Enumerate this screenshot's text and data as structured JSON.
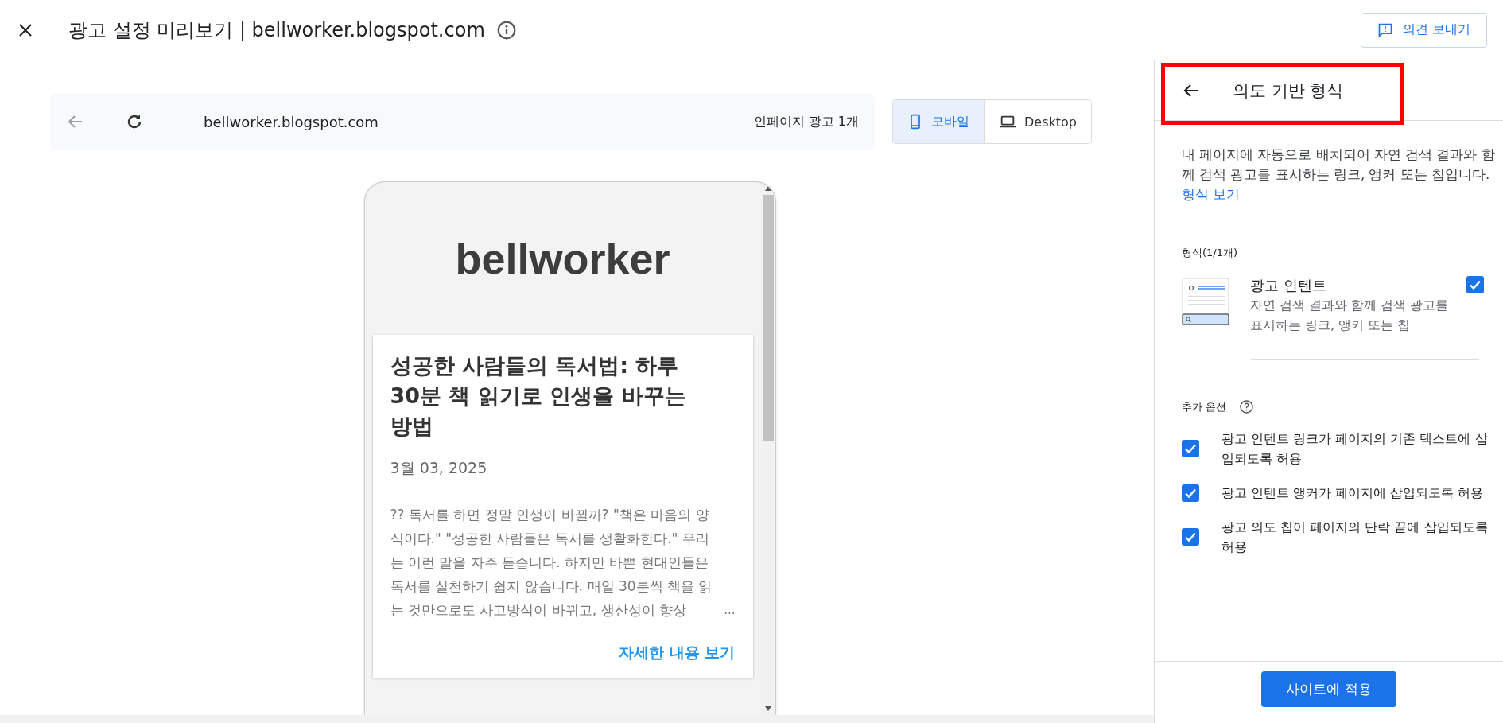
{
  "header": {
    "title": "광고 설정 미리보기 | bellworker.blogspot.com",
    "feedback_button": "의견 보내기"
  },
  "preview_bar": {
    "url": "bellworker.blogspot.com",
    "ad_count": "인페이지 광고 1개"
  },
  "device_toggle": [
    {
      "label": "모바일",
      "kind": "mobile",
      "selected": true
    },
    {
      "label": "Desktop",
      "kind": "desktop",
      "selected": false
    }
  ],
  "blog": {
    "site_title": "bellworker",
    "post_title": "성공한 사람들의 독서법: 하루 30분 책 읽기로 인생을 바꾸는 방법",
    "date": "3월 03, 2025",
    "excerpt": "?? 독서를 하면 정말 인생이 바뀔까? \"책은 마음의 양식이다.\" \"성공한 사람들은 독서를 생활화한다.\" 우리는 이런 말을 자주 듣습니다. 하지만 바쁜 현대인들은 독서를 실천하기 쉽지 않습니다. 매일 30분씩 책을 읽는 것만으로도 사고방식이 바뀌고, 생산성이 향상",
    "ellipsis": "...",
    "read_more": "자세한 내용 보기"
  },
  "panel": {
    "title": "의도 기반 형식",
    "description": "내 페이지에 자동으로 배치되어 자연 검색 결과와 함께 검색 광고를 표시하는 링크, 앵커 또는 칩입니다.",
    "link": "형식 보기",
    "formats_heading": "형식(1/1개)",
    "format": {
      "name": "광고 인텐트",
      "description": "자연 검색 결과와 함께 검색 광고를 표시하는 링크, 앵커 또는 칩",
      "checked": true
    },
    "options_heading": "추가 옵션",
    "options": [
      {
        "label": "광고 인텐트 링크가 페이지의 기존 텍스트에 삽입되도록 허용",
        "checked": true
      },
      {
        "label": "광고 인텐트 앵커가 페이지에 삽입되도록 허용",
        "checked": true
      },
      {
        "label": "광고 의도 칩이 페이지의 단락 끝에 삽입되도록 허용",
        "checked": true
      }
    ],
    "apply_button": "사이트에 적용"
  }
}
